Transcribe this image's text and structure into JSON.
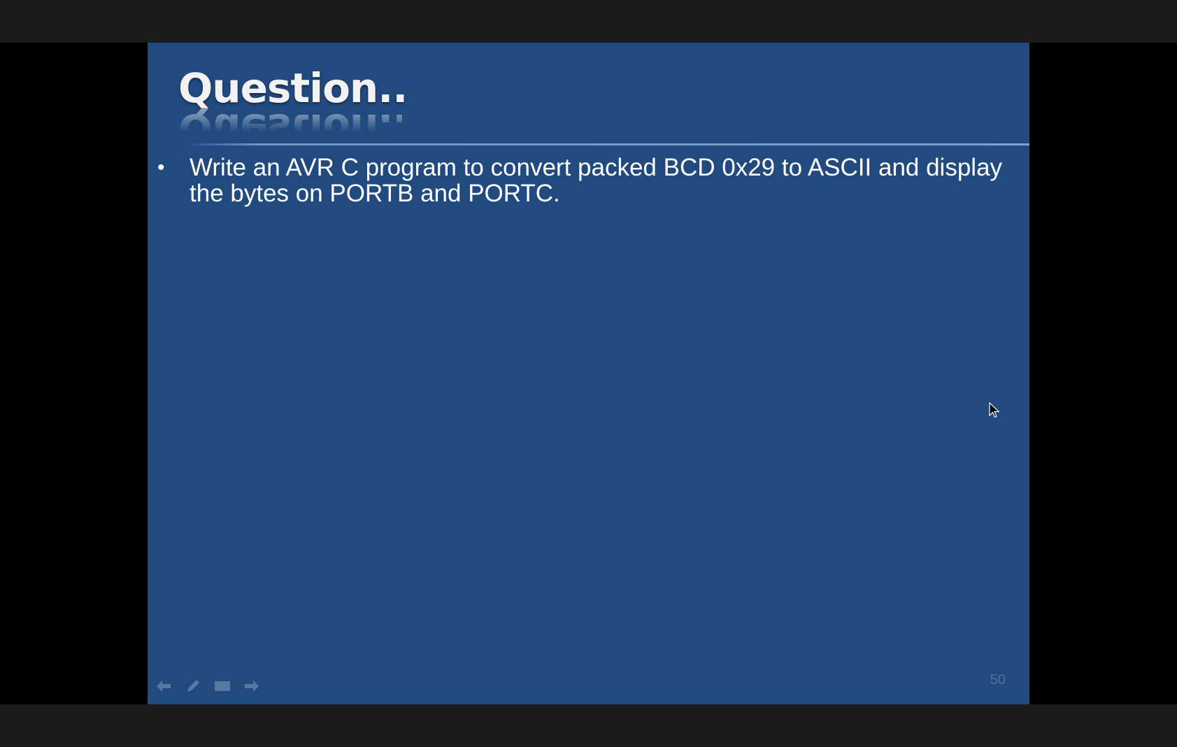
{
  "slide": {
    "title": "Question..",
    "bullets": [
      {
        "marker": "•",
        "text": "Write an AVR C program to convert packed BCD 0x29 to ASCII and display the bytes on PORTB and PORTC."
      }
    ],
    "slide_number": "50",
    "background_color": "#214a7f"
  },
  "nav_controls": {
    "previous_icon": "arrow-left-icon",
    "pen_icon": "pen-icon",
    "menu_icon": "slide-menu-icon",
    "next_icon": "arrow-right-icon"
  },
  "cursor_icon": "mouse-pointer-icon"
}
